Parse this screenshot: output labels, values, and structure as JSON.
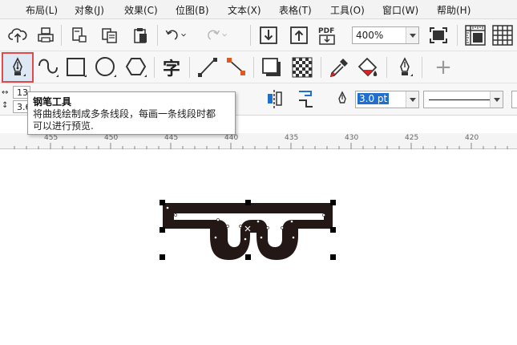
{
  "menu": [
    "布局(L)",
    "对象(J)",
    "效果(C)",
    "位图(B)",
    "文本(X)",
    "表格(T)",
    "工具(O)",
    "窗口(W)",
    "帮助(H)"
  ],
  "toolbar1": {
    "icons": [
      "cloud-upload-icon",
      "print-icon",
      "export-icon",
      "copy-icon",
      "paste-icon",
      "undo-icon",
      "redo-icon",
      "import-icon",
      "export-arrow-icon",
      "pdf-icon",
      "zoom-fit-icon",
      "rulers-icon",
      "grid-icon"
    ],
    "pdf_label": "PDF",
    "zoom_value": "400%"
  },
  "toolbar2": {
    "icons": [
      "pen-icon",
      "curve-icon",
      "rectangle-icon",
      "ellipse-icon",
      "polygon-icon",
      "text-icon",
      "line-icon",
      "connector-icon",
      "shadow-icon",
      "transparency-icon",
      "eyedropper-icon",
      "fill-icon",
      "pen-outline-icon",
      "add-icon"
    ],
    "text_tool_glyph": "字",
    "add_glyph": "+"
  },
  "propbar": {
    "x_value": "13.",
    "y_value": "3.6",
    "outline_width": "3.0 pt"
  },
  "tooltip": {
    "title": "钢笔工具",
    "line1": "将曲线绘制成多条线段，每画一条线段时都",
    "line2": "可以进行预览."
  },
  "ruler": {
    "labels": [
      "455",
      "450",
      "445",
      "440",
      "435",
      "430",
      "425",
      "420"
    ]
  },
  "colors": {
    "selection_border": "#e24a4a",
    "active_bg": "#dde8f5",
    "shape_fill": "#231815",
    "outline_highlight": "#1f6fd1"
  }
}
